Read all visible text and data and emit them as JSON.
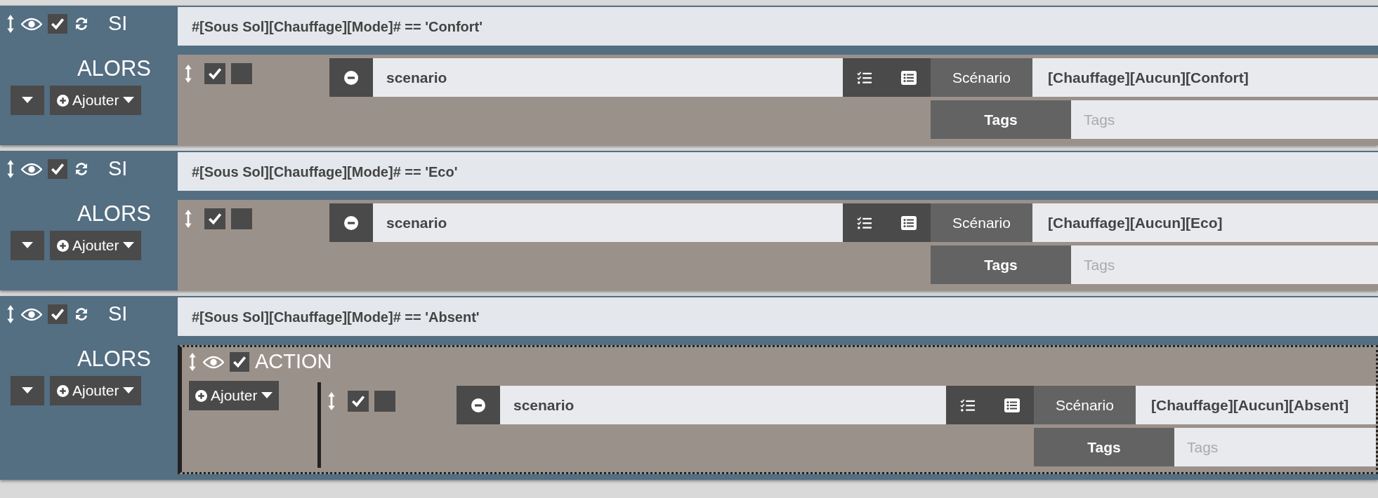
{
  "blocks": [
    {
      "enabled": true,
      "si_label": "SI",
      "condition": "#[Sous Sol][Chauffage][Mode]# == 'Confort'",
      "alors_label": "ALORS",
      "add_button": "Ajouter",
      "items": [
        {
          "kind": "action",
          "checked": true,
          "option_checked": false,
          "name": "scenario",
          "field_label": "Scénario",
          "value": "[Chauffage][Aucun][Confort]",
          "tags_label": "Tags",
          "tags_placeholder": "Tags"
        }
      ]
    },
    {
      "enabled": true,
      "si_label": "SI",
      "condition": "#[Sous Sol][Chauffage][Mode]# == 'Eco'",
      "alors_label": "ALORS",
      "add_button": "Ajouter",
      "items": [
        {
          "kind": "action",
          "checked": true,
          "option_checked": false,
          "name": "scenario",
          "field_label": "Scénario",
          "value": "[Chauffage][Aucun][Eco]",
          "tags_label": "Tags",
          "tags_placeholder": "Tags"
        }
      ]
    },
    {
      "enabled": true,
      "si_label": "SI",
      "condition": "#[Sous Sol][Chauffage][Mode]# == 'Absent'",
      "alors_label": "ALORS",
      "add_button": "Ajouter",
      "items": [
        {
          "kind": "group",
          "checked": true,
          "title": "ACTION",
          "add_button": "Ajouter",
          "children": [
            {
              "kind": "action",
              "checked": true,
              "option_checked": false,
              "name": "scenario",
              "field_label": "Scénario",
              "value": "[Chauffage][Aucun][Absent]",
              "tags_label": "Tags",
              "tags_placeholder": "Tags"
            }
          ]
        }
      ]
    }
  ]
}
